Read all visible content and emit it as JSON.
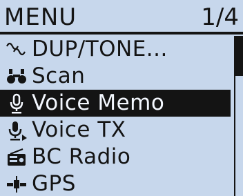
{
  "header": {
    "title": "MENU",
    "page": "1/4"
  },
  "menu": {
    "items": [
      {
        "label": "DUP/TONE...",
        "icon": "dup-tone-icon",
        "selected": false
      },
      {
        "label": "Scan",
        "icon": "binoculars-icon",
        "selected": false
      },
      {
        "label": "Voice Memo",
        "icon": "microphone-icon",
        "selected": true
      },
      {
        "label": "Voice TX",
        "icon": "voice-tx-icon",
        "selected": false
      },
      {
        "label": "BC Radio",
        "icon": "radio-icon",
        "selected": false
      },
      {
        "label": "GPS",
        "icon": "satellite-icon",
        "selected": false
      }
    ]
  },
  "scrollbar": {
    "position_fraction": 0.25
  },
  "colors": {
    "lcd_background": "#c7d7ec",
    "text": "#141414",
    "selected_background": "#141414",
    "selected_text": "#f4f8ff"
  }
}
